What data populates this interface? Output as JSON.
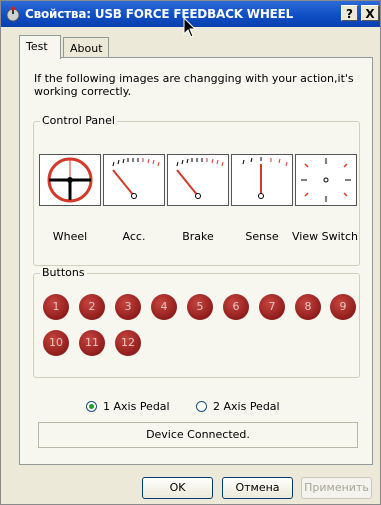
{
  "window": {
    "title": "Свойства: USB FORCE FEEDBACK WHEEL",
    "help_btn": "?",
    "close_btn": "X"
  },
  "tabs": [
    {
      "label": "Test",
      "active": true
    },
    {
      "label": "About",
      "active": false
    }
  ],
  "intro_text": "If the following images are changging with your action,it's working correctly.",
  "control_panel": {
    "label": "Control Panel",
    "gauges": [
      {
        "label": "Wheel",
        "icon": "steering-wheel-icon"
      },
      {
        "label": "Acc.",
        "icon": "accelerator-gauge-icon"
      },
      {
        "label": "Brake",
        "icon": "brake-gauge-icon"
      },
      {
        "label": "Sense",
        "icon": "sense-gauge-icon"
      },
      {
        "label": "View Switch",
        "icon": "view-switch-icon"
      }
    ]
  },
  "buttons_group": {
    "label": "Buttons",
    "buttons": [
      "1",
      "2",
      "3",
      "4",
      "5",
      "6",
      "7",
      "8",
      "9",
      "10",
      "11",
      "12"
    ]
  },
  "pedal_mode": {
    "options": [
      "1 Axis Pedal",
      "2 Axis Pedal"
    ],
    "selected": "1 Axis Pedal"
  },
  "status_text": "Device Connected.",
  "dialog_buttons": {
    "ok": "OK",
    "cancel": "Отмена",
    "apply": "Применить"
  },
  "colors": {
    "titlebar": "#0f4fc4",
    "button_red": "#8f1d1b",
    "gauge_red": "#d23a2a"
  }
}
